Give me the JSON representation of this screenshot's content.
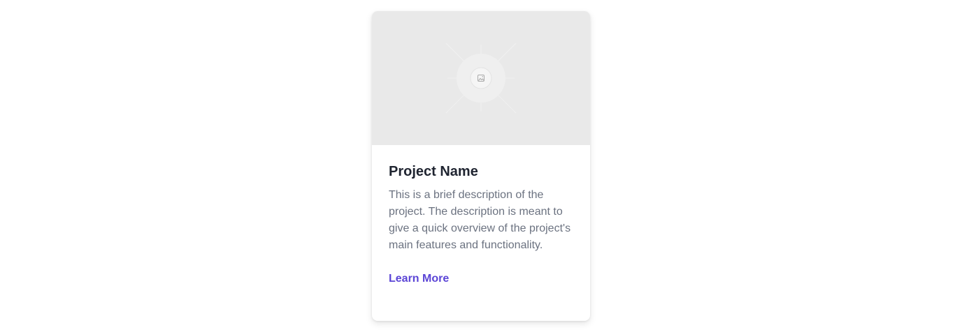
{
  "card": {
    "image": {
      "icon": "image-placeholder-icon"
    },
    "title": "Project Name",
    "description": "This is a brief description of the project. The description is meant to give a quick overview of the project's main features and functionality.",
    "link_label": "Learn More"
  },
  "colors": {
    "background": "#ffffff",
    "card_background": "#ffffff",
    "image_background": "#e9e9e9",
    "title": "#1f2430",
    "description": "#6b7280",
    "link": "#5b45d6"
  }
}
